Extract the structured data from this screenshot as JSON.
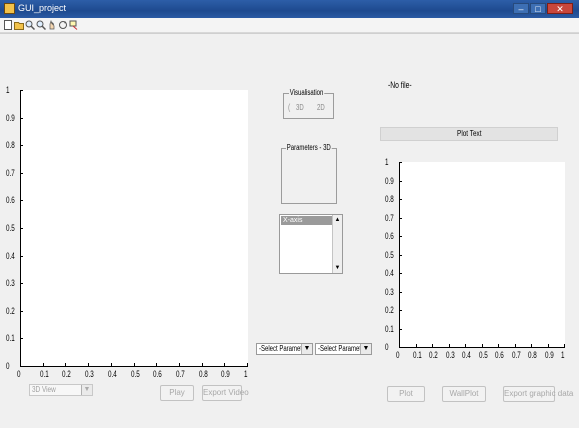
{
  "window": {
    "title": "GUI_project",
    "controls": {
      "minimize": "–",
      "maximize": "□",
      "close": "✕"
    }
  },
  "toolbar": {
    "icons": [
      "new-icon",
      "open-icon",
      "zoom-in-icon",
      "zoom-out-icon",
      "pan-icon",
      "rotate-icon",
      "datacursor-icon"
    ]
  },
  "left_axes": {
    "y_ticks": [
      "1",
      "0.9",
      "0.8",
      "0.7",
      "0.6",
      "0.5",
      "0.4",
      "0.3",
      "0.2",
      "0.1",
      "0"
    ],
    "x_ticks": [
      "0",
      "0.1",
      "0.2",
      "0.3",
      "0.4",
      "0.5",
      "0.6",
      "0.7",
      "0.8",
      "0.9",
      "1"
    ]
  },
  "right_axes": {
    "y_ticks": [
      "1",
      "0.9",
      "0.8",
      "0.7",
      "0.6",
      "0.5",
      "0.4",
      "0.3",
      "0.2",
      "0.1",
      "0"
    ],
    "x_ticks": [
      "0",
      "0.1",
      "0.2",
      "0.3",
      "0.4",
      "0.5",
      "0.6",
      "0.7",
      "0.8",
      "0.9",
      "1"
    ]
  },
  "visualisation": {
    "title": "Visualisation",
    "opt3d": "3D",
    "opt2d": "2D"
  },
  "parameters_3d": {
    "title": "Parameters - 3D"
  },
  "axis_list": {
    "selected": "X-axis",
    "up": "▲",
    "down": "▼"
  },
  "selects": {
    "param1": "-Select Parameters-",
    "param2": "-Select Parameters-",
    "arrow": "▼"
  },
  "view_select": {
    "value": "3D View",
    "arrow": "▼"
  },
  "buttons": {
    "play": "Play",
    "export_video": "Export Video",
    "plot": "Plot",
    "wallplot": "WallPlot",
    "export_graphic": "Export graphic data"
  },
  "file_label": "-No file-",
  "plot_text": "Plot Text"
}
